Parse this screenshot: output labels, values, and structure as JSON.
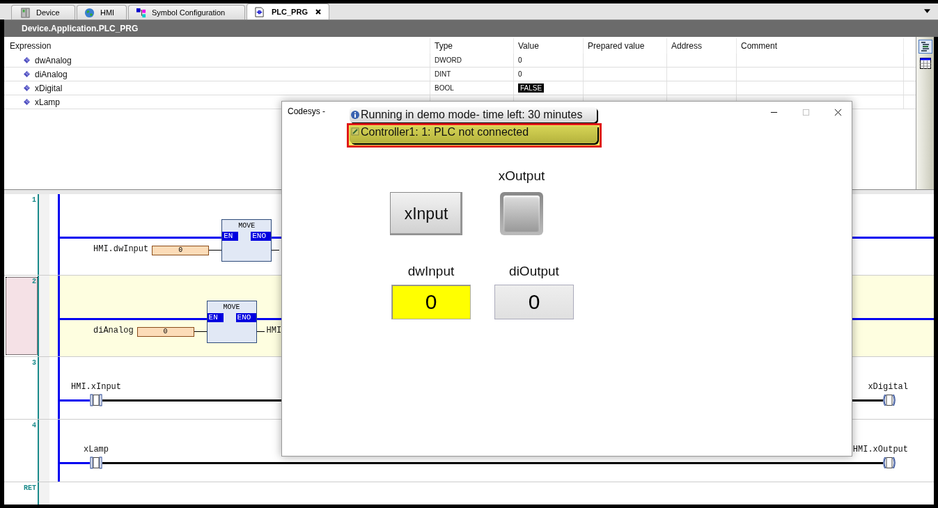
{
  "tabs": [
    {
      "label": "Device",
      "selected": false
    },
    {
      "label": "HMI",
      "selected": false
    },
    {
      "label": "Symbol Configuration",
      "selected": false
    },
    {
      "label": "PLC_PRG",
      "selected": true
    }
  ],
  "editor_title": "Device.Application.PLC_PRG",
  "watch": {
    "columns": [
      "Expression",
      "Type",
      "Value",
      "Prepared value",
      "Address",
      "Comment"
    ],
    "rows": [
      {
        "expression": "dwAnalog",
        "type": "DWORD",
        "value": "0",
        "kind": "number"
      },
      {
        "expression": "diAnalog",
        "type": "DINT",
        "value": "0",
        "kind": "number"
      },
      {
        "expression": "xDigital",
        "type": "BOOL",
        "value": "FALSE",
        "kind": "bool"
      },
      {
        "expression": "xLamp"
      }
    ]
  },
  "ladder": {
    "networks": [
      {
        "number": "1",
        "selected": false,
        "kind": "move",
        "block": "MOVE",
        "en": "EN",
        "eno": "ENO",
        "input": "HMI.dwInput",
        "input_value": "0"
      },
      {
        "number": "2",
        "selected": true,
        "kind": "move",
        "block": "MOVE",
        "en": "EN",
        "eno": "ENO",
        "input": "diAnalog",
        "input_value": "0",
        "output": "HMI"
      },
      {
        "number": "3",
        "selected": false,
        "kind": "coil",
        "contact": "HMI.xInput",
        "coil": "xDigital"
      },
      {
        "number": "4",
        "selected": false,
        "kind": "coil",
        "contact": "xLamp",
        "coil": "HMI.xOutput"
      }
    ],
    "end_label": "RET"
  },
  "dialog": {
    "title": "Codesys -",
    "demo_banner": "Running in demo mode- time left: 30 minutes",
    "status_banner": "Controller1: 1: PLC not connected",
    "button": "xInput",
    "lamp_label": "xOutput",
    "lamp_on": false,
    "fields": [
      {
        "label": "dwInput",
        "value": "0",
        "kind": "input"
      },
      {
        "label": "diOutput",
        "value": "0",
        "kind": "output"
      }
    ]
  }
}
